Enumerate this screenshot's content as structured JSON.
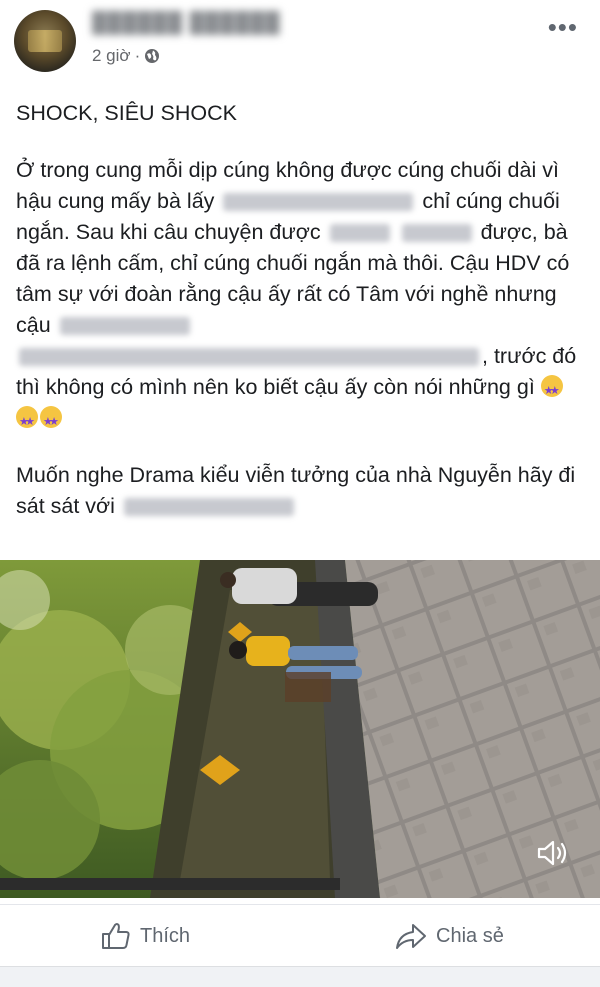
{
  "post": {
    "time": "2 giờ",
    "separator": "·",
    "paragraph_1": "SHOCK, SIÊU SHOCK",
    "paragraph_2": {
      "part_1": "Ở trong cung mỗi dịp cúng không được cúng chuối dài vì hậu cung mấy bà lấy",
      "part_2": "chỉ cúng chuối ngắn. Sau khi câu chuyện được",
      "part_3": "được, bà đã ra lệnh cấm, chỉ cúng chuối ngắn mà thôi. Cậu HDV có tâm sự với đoàn rằng cậu ấy rất có Tâm với nghề nhưng cậu",
      "part_4": ", trước đó thì không có mình nên ko biết cậu ấy còn nói những gì"
    },
    "paragraph_3": "Muốn nghe Drama kiểu viễn tưởng của nhà Nguyễn hãy đi sát sát với"
  },
  "icons": {
    "more": "more-options-icon",
    "privacy": "globe-icon",
    "volume": "volume-icon",
    "like": "thumbs-up-icon",
    "share": "share-arrow-icon",
    "emoji": "star-struck-emoji"
  },
  "actions": {
    "like_label": "Thích",
    "share_label": "Chia sẻ"
  }
}
